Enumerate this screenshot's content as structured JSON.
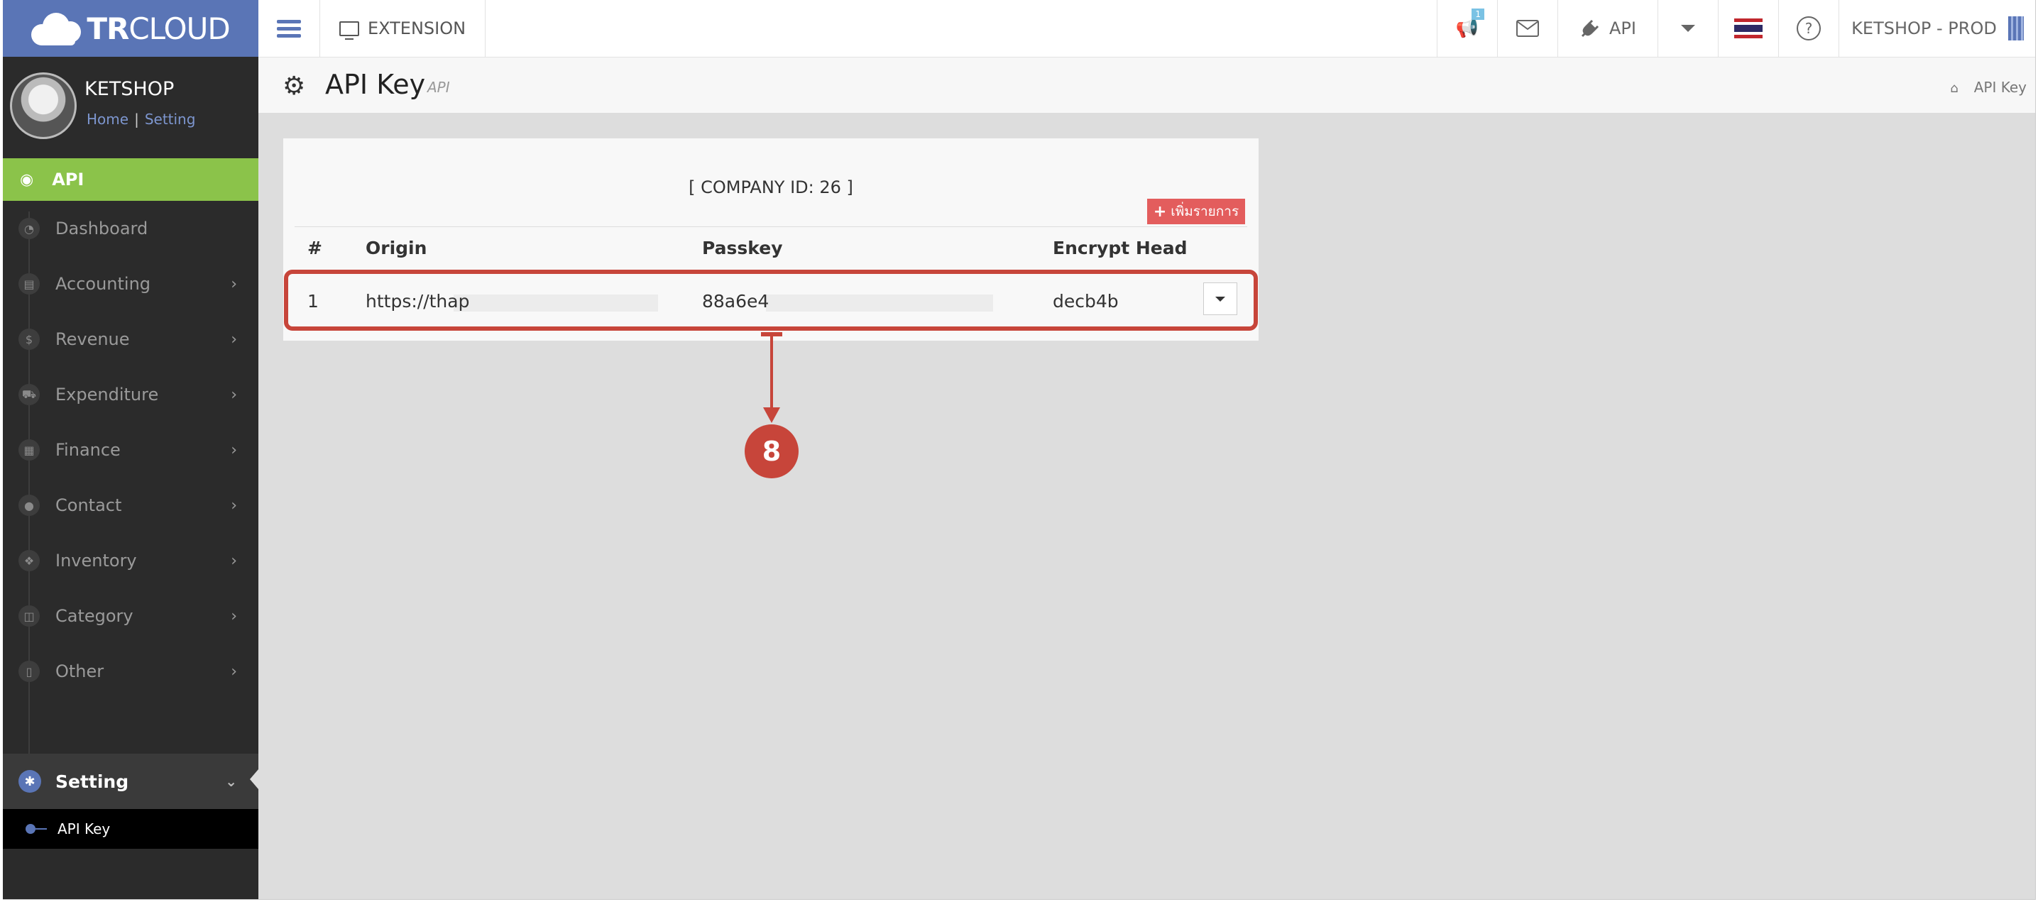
{
  "brand": {
    "bold": "TR",
    "rest": "CLOUD"
  },
  "topbar": {
    "extension_label": "EXTENSION",
    "notif_count": "1",
    "api_label": "API",
    "help_glyph": "?",
    "company_label": "KETSHOP - PROD"
  },
  "profile": {
    "name": "KETSHOP",
    "link_home": "Home",
    "link_setting": "Setting",
    "sep": "|"
  },
  "sidebar": {
    "active_label": "API",
    "items": [
      {
        "label": "Dashboard",
        "icon": "dashboard-icon"
      },
      {
        "label": "Accounting",
        "icon": "book-icon"
      },
      {
        "label": "Revenue",
        "icon": "dollar-icon"
      },
      {
        "label": "Expenditure",
        "icon": "cart-icon"
      },
      {
        "label": "Finance",
        "icon": "calendar-icon"
      },
      {
        "label": "Contact",
        "icon": "user-icon"
      },
      {
        "label": "Inventory",
        "icon": "cubes-icon"
      },
      {
        "label": "Category",
        "icon": "columns-icon"
      },
      {
        "label": "Other",
        "icon": "file-icon"
      }
    ],
    "setting_label": "Setting",
    "sub_label": "API Key"
  },
  "page": {
    "title": "API Key",
    "subtitle": "API",
    "breadcrumb": "API Key"
  },
  "panel": {
    "company": "[ COMPANY ID: 26 ]",
    "add_button": "เพิ่มรายการ",
    "columns": [
      "#",
      "Origin",
      "Passkey",
      "Encrypt Head"
    ],
    "rows": [
      {
        "num": "1",
        "origin": "https://thap",
        "passkey": "88a6e4",
        "encrypt": "decb4b"
      }
    ]
  },
  "annotation": {
    "step": "8"
  },
  "colors": {
    "brand": "#5a75b6",
    "active": "#8bc34a",
    "danger": "#e35d5d",
    "annotation": "#c7453a"
  }
}
